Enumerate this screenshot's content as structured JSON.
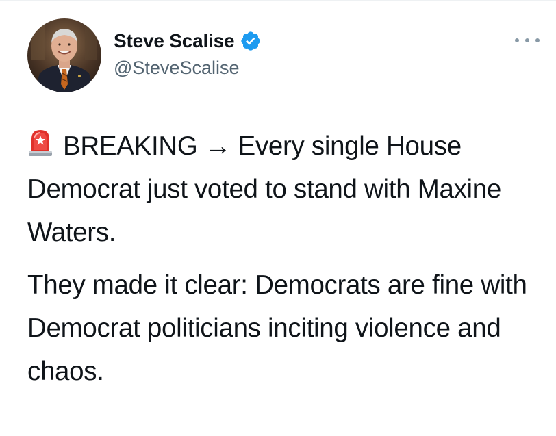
{
  "tweet": {
    "author": {
      "display_name": "Steve Scalise",
      "handle": "@SteveScalise",
      "verified": true,
      "verified_icon": "verified-badge-icon"
    },
    "more_icon": "more-options-icon",
    "body": {
      "paragraph_1": {
        "emoji_icon": "police-siren-icon",
        "text": "BREAKING → Every single House Democrat just voted to stand with Maxine Waters."
      },
      "paragraph_2": {
        "text": "They made it clear: Democrats are fine with Democrat politicians inciting violence and chaos."
      }
    }
  },
  "colors": {
    "verified_badge": "#1d9bf0",
    "handle_text": "#536471",
    "body_text": "#0f1419"
  }
}
